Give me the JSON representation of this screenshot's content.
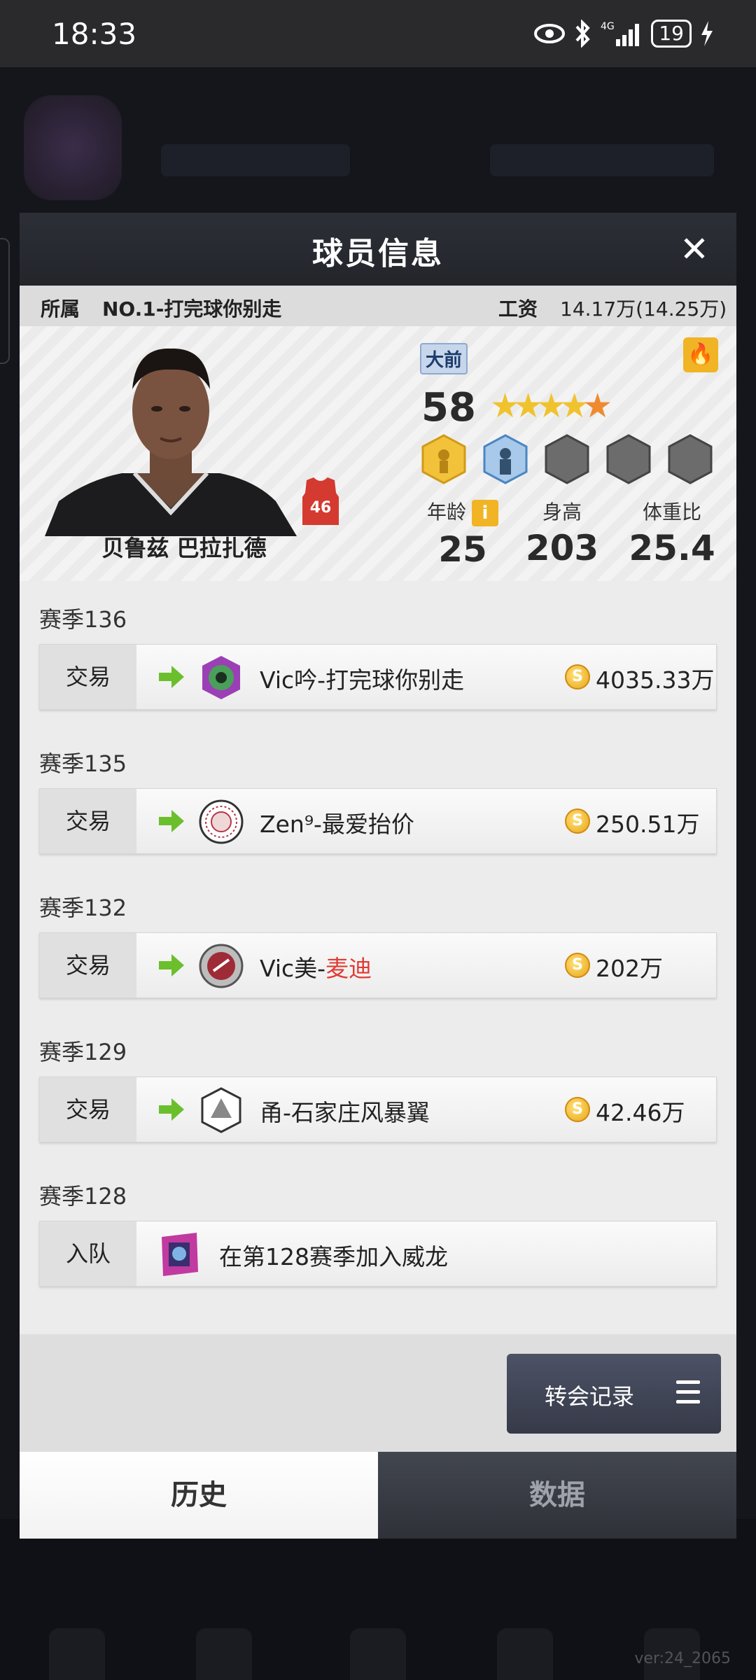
{
  "status_bar": {
    "time": "18:33",
    "battery": "19"
  },
  "background": {
    "version": "ver:24_2065"
  },
  "modal": {
    "title": "球员信息",
    "info": {
      "affiliation_label": "所属",
      "affiliation_value": "NO.1-打完球你别走",
      "salary_label": "工资",
      "salary_value": "14.17万(14.25万)"
    },
    "player": {
      "name": "贝鲁兹 巴拉扎德",
      "jersey_number": "46",
      "position_tag": "大前",
      "rating": "58",
      "stars": 4.5,
      "age_label": "年龄",
      "age": "25",
      "height_label": "身高",
      "height": "203",
      "weight_ratio_label": "体重比",
      "weight_ratio": "25.4"
    },
    "history": [
      {
        "season": "赛季136",
        "type": "交易",
        "team": "Vic吟-打完球你别走",
        "price": "4035.33万",
        "logo_color": "#9b3fb5"
      },
      {
        "season": "赛季135",
        "type": "交易",
        "team": "Zen⁹-最爱抬价",
        "price": "250.51万",
        "logo_color": "#b3384a"
      },
      {
        "season": "赛季132",
        "type": "交易",
        "team_prefix": "Vic美-",
        "team_highlight": "麦迪",
        "price": "202万",
        "logo_color": "#9e2b36"
      },
      {
        "season": "赛季129",
        "type": "交易",
        "team": "甬-石家庄风暴翼",
        "price": "42.46万",
        "logo_color": "#555555"
      },
      {
        "season": "赛季128",
        "type": "入队",
        "team": "在第128赛季加入威龙",
        "logo_color": "#c03aa0"
      }
    ],
    "transfer_button": "转会记录",
    "tabs": {
      "history": "历史",
      "data": "数据"
    }
  }
}
